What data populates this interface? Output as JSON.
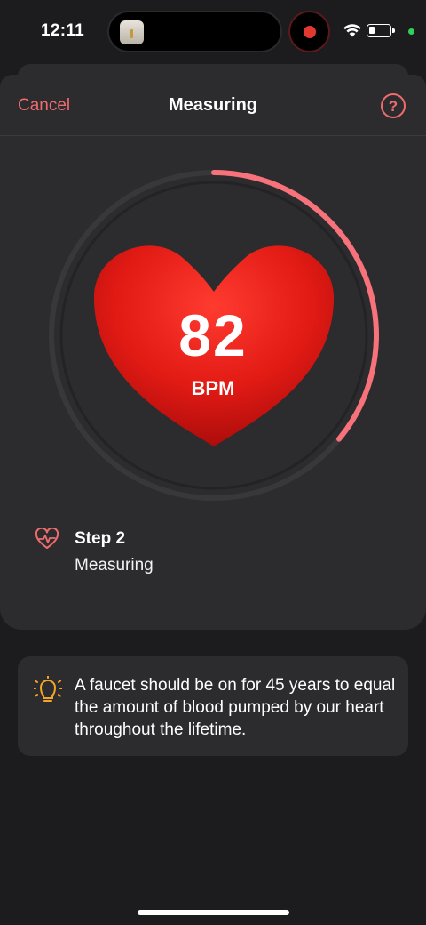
{
  "status_bar": {
    "time": "12:11",
    "icons": [
      "app-thumbnail-icon",
      "screen-record-icon",
      "wifi-icon",
      "battery-icon",
      "privacy-indicator-dot"
    ]
  },
  "nav": {
    "cancel_label": "Cancel",
    "title": "Measuring",
    "help_label": "?"
  },
  "measurement": {
    "bpm": "82",
    "unit": "BPM",
    "progress": 0.36,
    "colors": {
      "progress": "#f7727a",
      "heart_top": "#ff3b30",
      "heart_bottom": "#a30a0a",
      "track": "#38383a"
    }
  },
  "step": {
    "title": "Step 2",
    "subtitle": "Measuring",
    "icon": "heart-pulse-icon"
  },
  "tip": {
    "icon": "lightbulb-icon",
    "text": "A faucet should be on for 45 years to equal the amount of blood pumped by our heart throughout the lifetime."
  },
  "colors": {
    "accent": "#ee6b6e",
    "background": "#1c1c1e",
    "card": "#2c2c2e",
    "tip_icon": "#f5a623"
  }
}
